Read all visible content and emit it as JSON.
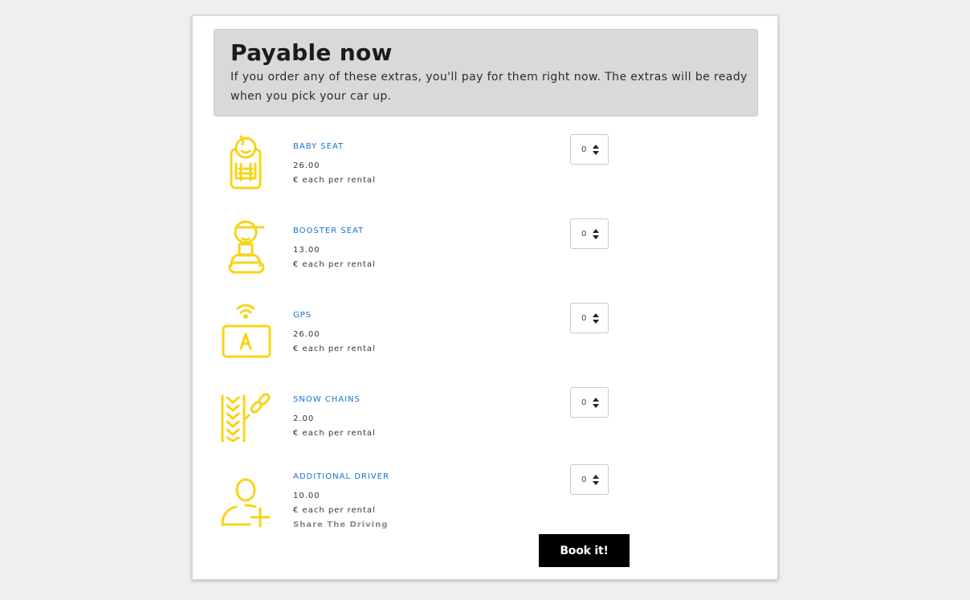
{
  "header": {
    "title": "Payable now",
    "description": "If you order any of these extras, you'll pay for them right now. The extras will be ready when you pick your car up."
  },
  "colors": {
    "icon": "#f7d417",
    "link": "#1a73c8",
    "header_bg": "#d8d9da",
    "button_bg": "#000000"
  },
  "extras": [
    {
      "name": "BABY SEAT",
      "price": "26.00",
      "unit": "€ each per rental",
      "subtitle": "",
      "quantity": "0",
      "icon": "baby-seat-icon"
    },
    {
      "name": "BOOSTER SEAT",
      "price": "13.00",
      "unit": "€ each per rental",
      "subtitle": "",
      "quantity": "0",
      "icon": "booster-seat-icon"
    },
    {
      "name": "GPS",
      "price": "26.00",
      "unit": "€ each per rental",
      "subtitle": "",
      "quantity": "0",
      "icon": "gps-icon"
    },
    {
      "name": "SNOW CHAINS",
      "price": "2.00",
      "unit": "€ each per rental",
      "subtitle": "",
      "quantity": "0",
      "icon": "snow-chains-icon"
    },
    {
      "name": "ADDITIONAL DRIVER",
      "price": "10.00",
      "unit": "€ each per rental",
      "subtitle": "Share The Driving",
      "quantity": "0",
      "icon": "additional-driver-icon"
    }
  ],
  "actions": {
    "book_label": "Book it!"
  }
}
